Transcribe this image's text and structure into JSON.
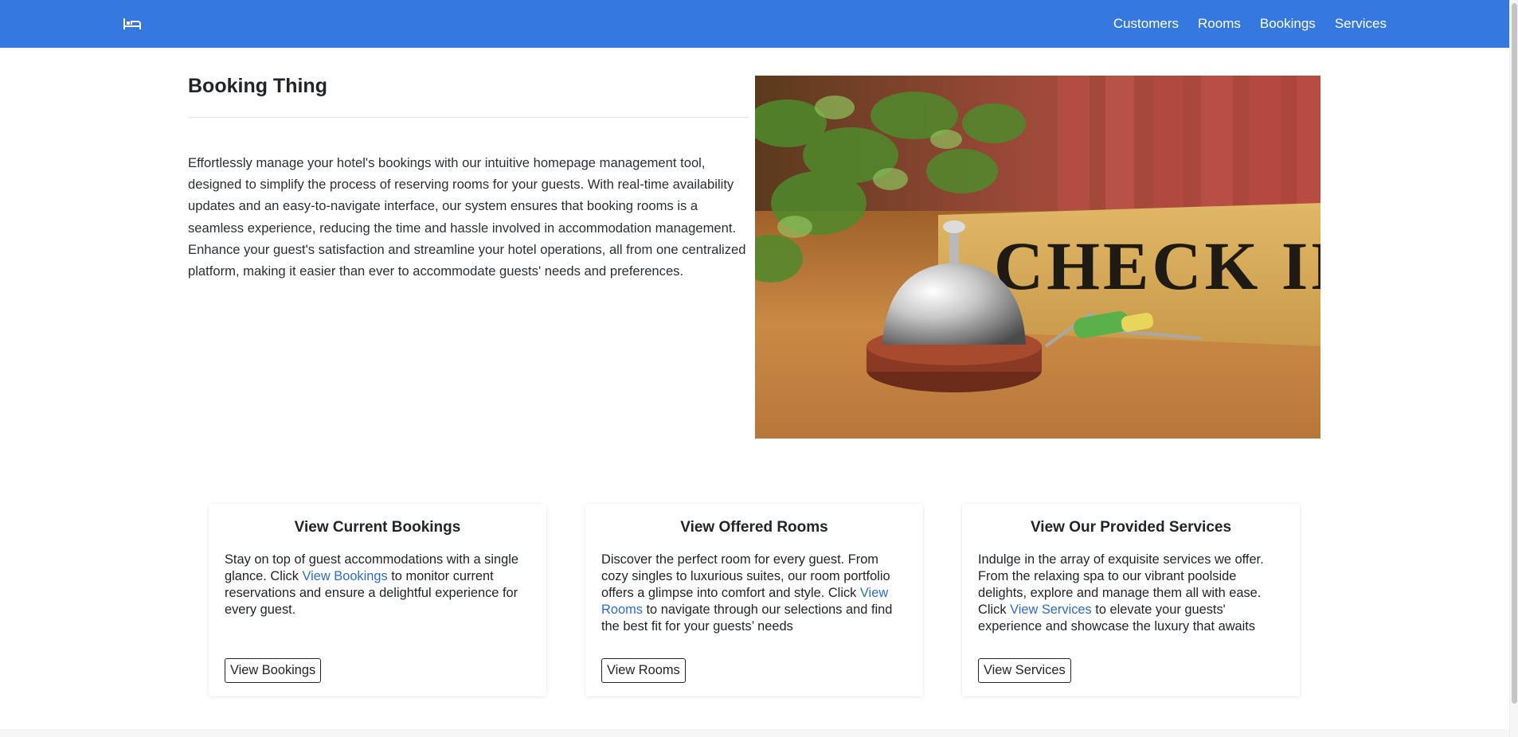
{
  "nav": {
    "brand_icon": "bed-icon",
    "links": [
      "Customers",
      "Rooms",
      "Bookings",
      "Services"
    ]
  },
  "hero": {
    "title": "Booking Thing",
    "description": "Effortlessly manage your hotel's bookings with our intuitive homepage management tool, designed to simplify the process of reserving rooms for your guests. With real-time availability updates and an easy-to-navigate interface, our system ensures that booking rooms is a seamless experience, reducing the time and hassle involved in accommodation management. Enhance your guest's satisfaction and streamline your hotel operations, all from one centralized platform, making it easier than ever to accommodate guests' needs and preferences.",
    "image_sign_text": "CHECK IN"
  },
  "cards": [
    {
      "title": "View Current Bookings",
      "text_before": "Stay on top of guest accommodations with a single glance. Click ",
      "link": "View Bookings",
      "text_after": " to monitor current reservations and ensure a delightful experience for every guest.",
      "button": "View Bookings"
    },
    {
      "title": "View Offered Rooms",
      "text_before": "Discover the perfect room for every guest. From cozy singles to luxurious suites, our room portfolio offers a glimpse into comfort and style. Click ",
      "link": "View Rooms",
      "text_after": " to navigate through our selections and find the best fit for your guests’ needs",
      "button": "View Rooms"
    },
    {
      "title": "View Our Provided Services",
      "text_before": "Indulge in the array of exquisite services we offer. From the relaxing spa to our vibrant poolside delights, explore and manage them all with ease. Click ",
      "link": "View Services",
      "text_after": " to elevate your guests' experience and showcase the luxury that awaits",
      "button": "View Services"
    }
  ],
  "colors": {
    "navbar": "#3578e0",
    "link": "#2b6cd4"
  }
}
